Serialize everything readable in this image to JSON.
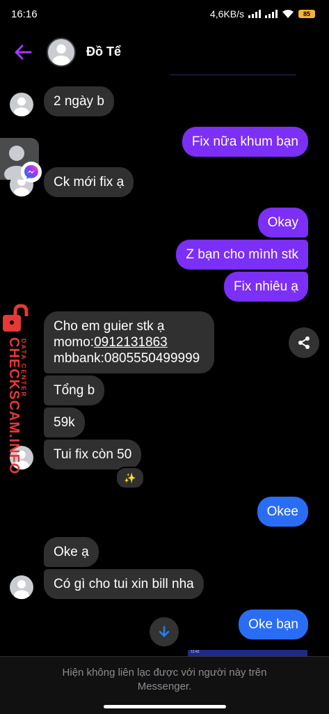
{
  "status": {
    "time": "16:16",
    "speed": "4,6KB/s",
    "battery": "85"
  },
  "header": {
    "name": "Đồ Tể"
  },
  "messages": {
    "m1": "2 ngày b",
    "m2": "Fix nữa khum bạn",
    "m3": "Ck mới fix ạ",
    "m4": "Okay",
    "m5": "Z bạn cho mình stk",
    "m6": "Fix nhiêu ạ",
    "m7_line1": "Cho em guier stk ạ",
    "m7_line2_prefix": "momo:",
    "m7_line2_phone": "0912131863",
    "m7_line3": "mbbank:0805550499999",
    "m8": "Tổng b",
    "m9": "59k",
    "m10": "Tui fix còn 50",
    "m11": "Okee",
    "m12": "Oke ạ",
    "m13": "Có gì cho tui xin bill nha",
    "m14": "Oke bạn"
  },
  "reaction": "✨",
  "watermark": {
    "main": "CHECKSCAM.INFO",
    "sub": "DATA CENTER"
  },
  "thumbnail": {
    "time": "12:42"
  },
  "footer": {
    "line1": "Hiện không liên lạc được với người này trên",
    "line2": "Messenger."
  },
  "colors": {
    "purple_bubble": "#7b2ff7",
    "blue_bubble": "#2a6df5",
    "incoming_bubble": "#303030",
    "back_arrow": "#a239ff",
    "watermark": "#e53935"
  },
  "icons": [
    "back-arrow-icon",
    "avatar-icon",
    "messenger-icon",
    "lock-icon",
    "share-icon",
    "sparkles-icon",
    "arrow-down-icon",
    "wifi-icon",
    "signal-icon",
    "battery-icon"
  ]
}
